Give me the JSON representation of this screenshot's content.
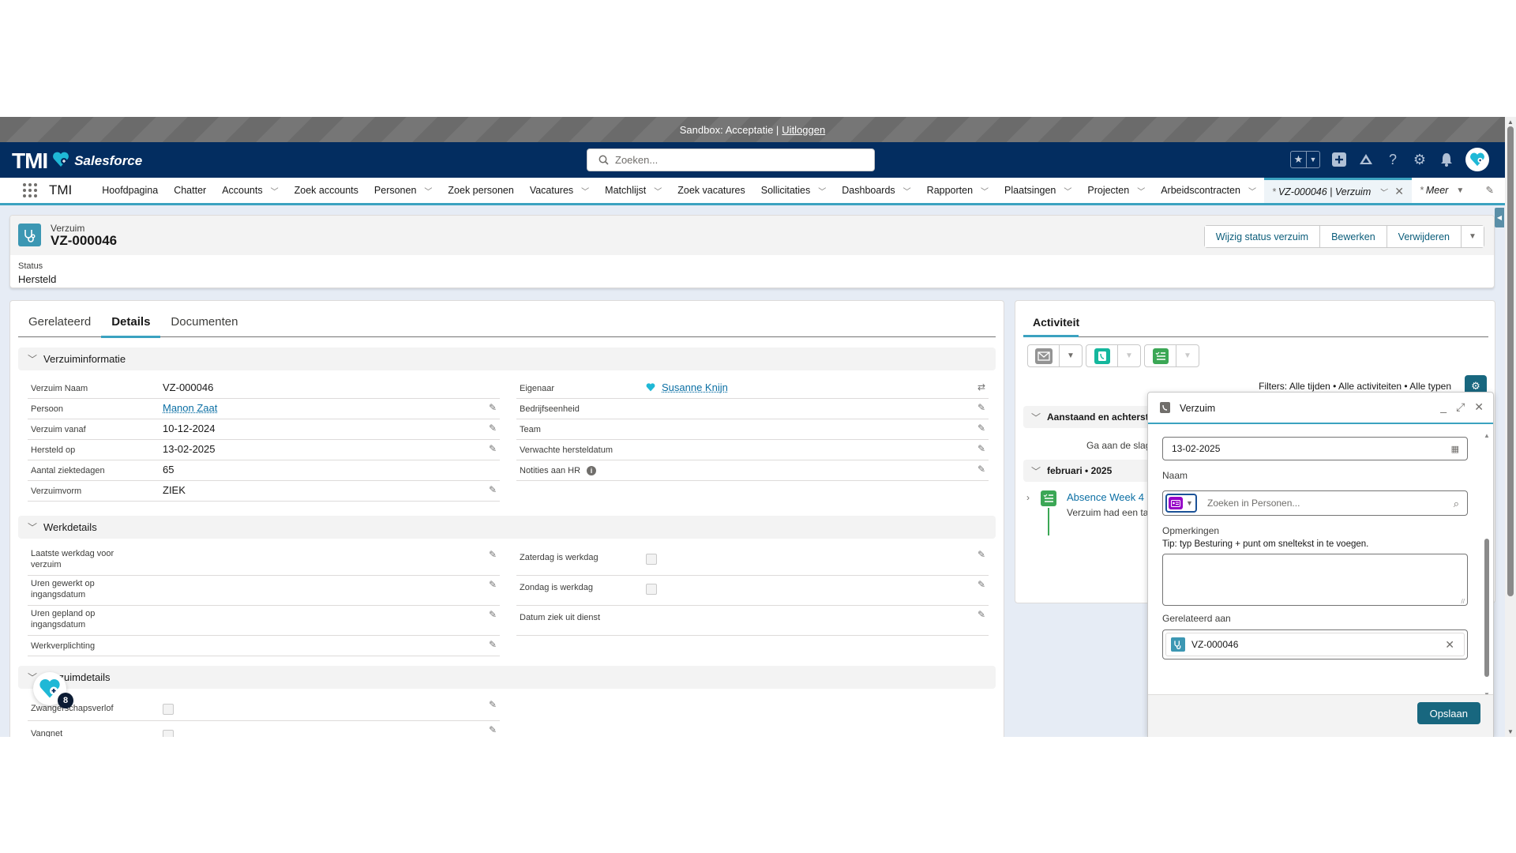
{
  "sandbox": {
    "text": "Sandbox: Acceptatie |",
    "logout": "Uitloggen"
  },
  "header": {
    "logo_text": "TMI",
    "brand_text": "Salesforce",
    "search_placeholder": "Zoeken...",
    "icons": [
      "favorites-star-icon",
      "favorites-dropdown-icon",
      "global-add-icon",
      "trailhead-icon",
      "help-icon",
      "setup-gear-icon",
      "notifications-bell-icon",
      "user-avatar"
    ]
  },
  "nav": {
    "app_name": "TMI",
    "items": [
      {
        "label": "Hoofdpagina",
        "dropdown": false
      },
      {
        "label": "Chatter",
        "dropdown": false
      },
      {
        "label": "Accounts",
        "dropdown": true
      },
      {
        "label": "Zoek accounts",
        "dropdown": false
      },
      {
        "label": "Personen",
        "dropdown": true
      },
      {
        "label": "Zoek personen",
        "dropdown": false
      },
      {
        "label": "Vacatures",
        "dropdown": true
      },
      {
        "label": "Matchlijst",
        "dropdown": true
      },
      {
        "label": "Zoek vacatures",
        "dropdown": false
      },
      {
        "label": "Sollicitaties",
        "dropdown": true
      },
      {
        "label": "Dashboards",
        "dropdown": true
      },
      {
        "label": "Rapporten",
        "dropdown": true
      },
      {
        "label": "Plaatsingen",
        "dropdown": true
      },
      {
        "label": "Projecten",
        "dropdown": true
      },
      {
        "label": "Arbeidscontracten",
        "dropdown": true
      }
    ],
    "active_tab": {
      "prefix": "*",
      "label": "VZ-000046 | Verzuim"
    },
    "more": {
      "prefix": "*",
      "label": "Meer"
    }
  },
  "record": {
    "object_type": "Verzuim",
    "name": "VZ-000046",
    "status_label": "Status",
    "status_value": "Hersteld",
    "actions": [
      "Wijzig status verzuim",
      "Bewerken",
      "Verwijderen"
    ]
  },
  "tabs": [
    {
      "label": "Gerelateerd",
      "active": false
    },
    {
      "label": "Details",
      "active": true
    },
    {
      "label": "Documenten",
      "active": false
    }
  ],
  "sections": {
    "verzuiminformatie": {
      "title": "Verzuiminformatie",
      "left": [
        {
          "label": "Verzuim Naam",
          "value": "VZ-000046",
          "editable": false
        },
        {
          "label": "Persoon",
          "value": "Manon Zaat",
          "link": true,
          "editable": true
        },
        {
          "label": "Verzuim vanaf",
          "value": "10-12-2024",
          "editable": true
        },
        {
          "label": "Hersteld op",
          "value": "13-02-2025",
          "editable": true
        },
        {
          "label": "Aantal ziektedagen",
          "value": "65",
          "editable": false
        },
        {
          "label": "Verzuimvorm",
          "value": "ZIEK",
          "editable": true
        }
      ],
      "right": [
        {
          "label": "Eigenaar",
          "value": "Susanne Knijn",
          "link": true
        },
        {
          "label": "Bedrijfseenheid",
          "value": ""
        },
        {
          "label": "Team",
          "value": ""
        },
        {
          "label": "Verwachte hersteldatum",
          "value": ""
        },
        {
          "label": "Notities aan HR",
          "value": "",
          "info": true
        }
      ]
    },
    "werkdetails": {
      "title": "Werkdetails",
      "left": [
        {
          "label": "Laatste werkdag voor verzuim",
          "value": ""
        },
        {
          "label": "Uren gewerkt op ingangsdatum",
          "value": ""
        },
        {
          "label": "Uren gepland op ingangsdatum",
          "value": ""
        },
        {
          "label": "Werkverplichting",
          "value": ""
        }
      ],
      "right": [
        {
          "label": "Zaterdag is werkdag",
          "checked": false
        },
        {
          "label": "Zondag is werkdag",
          "checked": false
        },
        {
          "label": "Datum ziek uit dienst",
          "value": ""
        }
      ]
    },
    "verzuimdetails": {
      "title": "Verzuimdetails",
      "left": [
        {
          "label": "Zwangerschapsverlof",
          "checked": false
        },
        {
          "label": "Vangnet",
          "checked": false
        }
      ]
    }
  },
  "activity": {
    "tab_label": "Activiteit",
    "filters": "Filters: Alle tijden • Alle activiteiten • Alle typen",
    "upcoming_section": "Aanstaand en achterstallig",
    "empty_text": "Ga aan de slag door een e-mail te verzenden",
    "month_section": "februari • 2025",
    "timeline": [
      {
        "title": "Absence Week 4",
        "description": "Verzuim had een taak"
      }
    ]
  },
  "composer": {
    "title": "Verzuim",
    "date_value": "13-02-2025",
    "naam_label": "Naam",
    "naam_placeholder": "Zoeken in Personen...",
    "opmerkingen_label": "Opmerkingen",
    "tip": "Tip: typ Besturing + punt om sneltekst in te voegen.",
    "opmerkingen_value": "",
    "related_label": "Gerelateerd aan",
    "related_value": "VZ-000046",
    "save_label": "Opslaan"
  },
  "utility": {
    "badge_count": "8"
  },
  "colors": {
    "brand_navy": "#032d60",
    "accent_teal": "#3ba2c0",
    "button_teal": "#18677f",
    "link_blue": "#0b6fa4"
  }
}
